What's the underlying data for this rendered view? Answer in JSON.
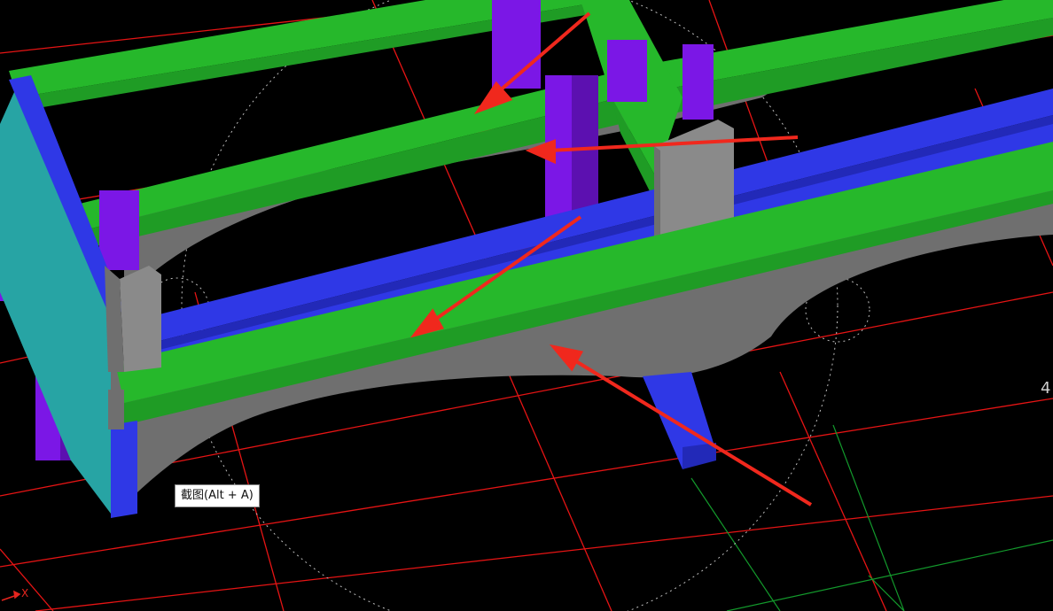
{
  "tooltip": {
    "text": "截图(Alt + A)"
  },
  "labels": {
    "right_edge": "4",
    "axis_x": "X"
  },
  "colors": {
    "background": "#000000",
    "grid_red": "#e61414",
    "grid_green": "#139a2c",
    "beam_green": "#26b82b",
    "beam_green_dark": "#1f9c25",
    "beam_blue": "#2f38e6",
    "beam_blue_dark": "#2229b8",
    "column_purple": "#7b17e6",
    "column_purple_dark": "#5c10b0",
    "girder_gray": "#6f6f6f",
    "girder_gray_light": "#8a8a8a",
    "panel_teal": "#27a4a4",
    "arrow_red": "#f0281d"
  }
}
